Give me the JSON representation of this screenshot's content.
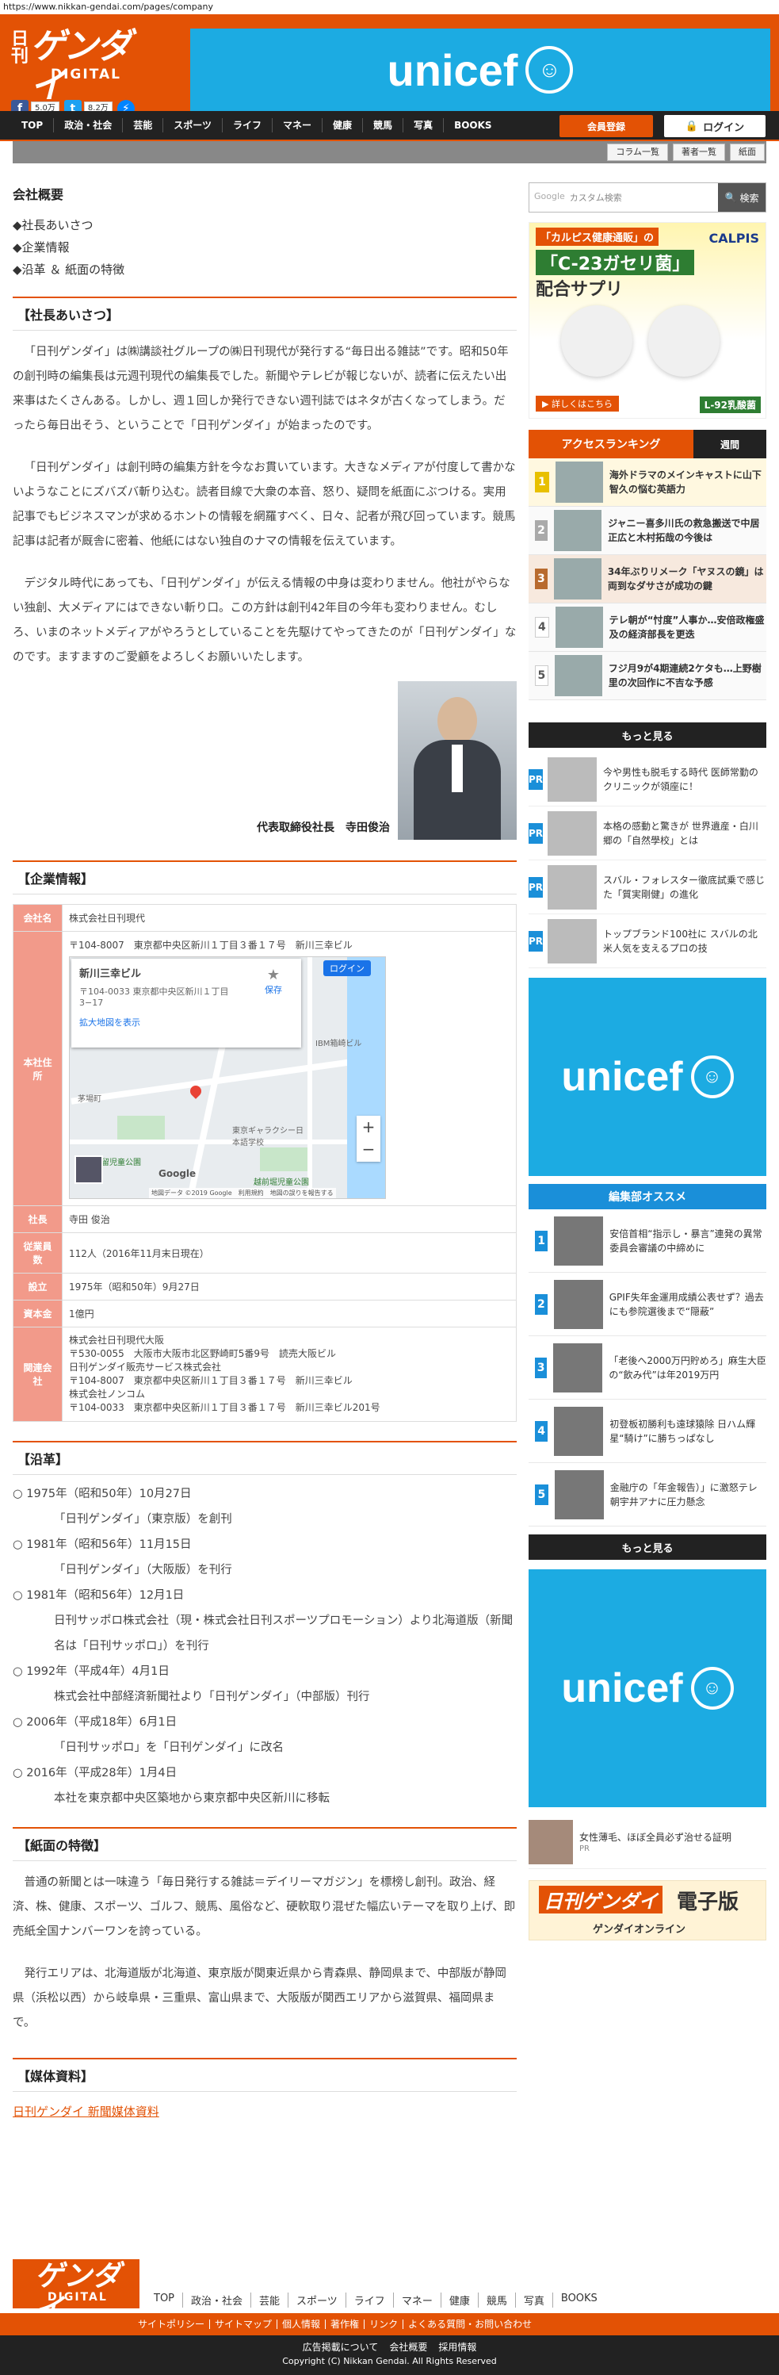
{
  "url": "https://www.nikkan-gendai.com/pages/company",
  "header": {
    "logo_vertical": "日刊",
    "logo_main": "ゲンダイ",
    "logo_sub": "DIGITAL",
    "fb_count": "5.0万",
    "tw_count": "8.2万",
    "banner_text": "unicef"
  },
  "nav": {
    "items": [
      "TOP",
      "政治・社会",
      "芸能",
      "スポーツ",
      "ライフ",
      "マネー",
      "健康",
      "競馬",
      "写真",
      "BOOKS"
    ],
    "register": "会員登録",
    "login": "ログイン"
  },
  "subnav": [
    "コラム一覧",
    "著者一覧",
    "紙面"
  ],
  "page": {
    "title": "会社概要",
    "toc": [
      "◆社長あいさつ",
      "◆企業情報",
      "◆沿革 ＆ 紙面の特徴"
    ]
  },
  "greeting": {
    "heading": "【社長あいさつ】",
    "p1": "「日刊ゲンダイ」は㈱講談社グループの㈱日刊現代が発行する“毎日出る雑誌”です。昭和50年の創刊時の編集長は元週刊現代の編集長でした。新聞やテレビが報じないが、読者に伝えたい出来事はたくさんある。しかし、週１回しか発行できない週刊誌ではネタが古くなってしまう。だったら毎日出そう、ということで「日刊ゲンダイ」が始まったのです。",
    "p2": "「日刊ゲンダイ」は創刊時の編集方針を今なお貫いています。大きなメディアが付度して書かないようなことにズバズバ斬り込む。読者目線で大衆の本音、怒り、疑問を紙面にぶつける。実用記事でもビジネスマンが求めるホントの情報を網羅すべく、日々、記者が飛び回っています。競馬記事は記者が厩舎に密着、他紙にはない独自のナマの情報を伝えています。",
    "p3": "デジタル時代にあっても、「日刊ゲンダイ」が伝える情報の中身は変わりません。他社がやらない独創、大メディアにはできない斬り口。この方針は創刊42年目の今年も変わりません。むしろ、いまのネットメディアがやろうとしていることを先駆けてやってきたのが「日刊ゲンダイ」なのです。ますますのご愛顧をよろしくお願いいたします。",
    "caption": "代表取締役社長　寺田俊治"
  },
  "company": {
    "heading": "【企業情報】",
    "rows": [
      {
        "k": "会社名",
        "v": "株式会社日刊現代"
      },
      {
        "k": "社長",
        "v": "寺田 俊治"
      },
      {
        "k": "従業員数",
        "v": "112人（2016年11月末日現在）"
      },
      {
        "k": "設立",
        "v": "1975年（昭和50年）9月27日"
      },
      {
        "k": "資本金",
        "v": "1億円"
      }
    ],
    "address_key": "本社住所",
    "address": "〒104-8007　東京都中央区新川１丁目３番１７号　新川三幸ビル",
    "map": {
      "place": "新川三幸ビル",
      "place_addr": "〒104-0033 東京都中央区新川１丁目 3−17",
      "save": "保存",
      "enlarge": "拡大地図を表示",
      "login": "ログイン",
      "label1": "IBM箱崎ビル",
      "label2": "東京ギャラクシー日本語学校",
      "label3": "堀留児童公園",
      "label4": "茅場町",
      "label5": "越前堀児童公園",
      "footer": "地図データ ©2019 Google　利用規約　地図の誤りを報告する",
      "google": "Google"
    },
    "related_key": "関連会社",
    "related": [
      "株式会社日刊現代大阪",
      "〒530-0055　大阪市大阪市北区野崎町5番9号　読売大阪ビル",
      "日刊ゲンダイ販売サービス株式会社",
      "〒104-8007　東京都中央区新川１丁目３番１７号　新川三幸ビル",
      "株式会社ノンコム",
      "〒104-0033　東京都中央区新川１丁目３番１７号　新川三幸ビル201号"
    ]
  },
  "history": {
    "heading": "【沿革】",
    "items": [
      {
        "date": "○ 1975年（昭和50年）10月27日",
        "desc": "「日刊ゲンダイ」（東京版）を創刊"
      },
      {
        "date": "○ 1981年（昭和56年）11月15日",
        "desc": "「日刊ゲンダイ」（大阪版）を刊行"
      },
      {
        "date": "○ 1981年（昭和56年）12月1日",
        "desc": "日刊サッポロ株式会社（現・株式会社日刊スポーツプロモーション）より北海道版（新聞名は「日刊サッポロ」）を刊行"
      },
      {
        "date": "○ 1992年（平成4年）4月1日",
        "desc": "株式会社中部経済新聞社より「日刊ゲンダイ」（中部版）刊行"
      },
      {
        "date": "○ 2006年（平成18年）6月1日",
        "desc": "「日刊サッポロ」を「日刊ゲンダイ」に改名"
      },
      {
        "date": "○ 2016年（平成28年）1月4日",
        "desc": "本社を東京都中央区築地から東京都中央区新川に移転"
      }
    ]
  },
  "features": {
    "heading": "【紙面の特徴】",
    "p1": "普通の新聞とは一味違う「毎日発行する雑誌＝デイリーマガジン」を標榜し創刊。政治、経済、株、健康、スポーツ、ゴルフ、競馬、風俗など、硬軟取り混ぜた幅広いテーマを取り上げ、即売紙全国ナンバーワンを誇っている。",
    "p2": "発行エリアは、北海道版が北海道、東京版が関東近県から青森県、静岡県まで、中部版が静岡県（浜松以西）から岐阜県・三重県、富山県まで、大阪版が関西エリアから滋賀県、福岡県まで。"
  },
  "media": {
    "heading": "【媒体資料】",
    "link": "日刊ゲンダイ 新聞媒体資料"
  },
  "side": {
    "search_placeholder": "カスタム検索",
    "search_brand": "Google",
    "search_button": "検索",
    "ad1": {
      "title": "「カルピス健康通販」の",
      "main": "「C-23ガセリ菌」",
      "sub": "配合サプリ",
      "brand": "CALPIS",
      "note": "▶ 詳しくはこちら",
      "tag": "L-92乳酸菌"
    },
    "ranking_tab": "アクセスランキング",
    "ranking_tab2": "週間",
    "ranking": [
      {
        "n": "1",
        "t": "海外ドラマのメインキャストに山下智久の悩む英語力"
      },
      {
        "n": "2",
        "t": "ジャニー喜多川氏の救急搬送で中居正広と木村拓哉の今後は"
      },
      {
        "n": "3",
        "t": "34年ぶりリメーク「ヤヌスの鏡」は両到なダサさが成功の鍵"
      },
      {
        "n": "4",
        "t": "テレ朝が“忖度”人事か…安倍政権盛及の経済部長を更迭"
      },
      {
        "n": "5",
        "t": "フジ月9が4期連続2ケタも…上野樹里の次回作に不吉な予感"
      }
    ],
    "more": "もっと見る",
    "pr": [
      {
        "t": "今や男性も脱毛する時代 医師常勤のクリニックが領座に！"
      },
      {
        "t": "本格の感動と驚きが 世界遺産・白川郷の「自然學校」とは"
      },
      {
        "t": "スバル・フォレスター徹底試乗で感じた「質実剛健」の進化"
      },
      {
        "t": "トップブランド100社に スバルの北米人気を支えるプロの技"
      }
    ],
    "pr_label": "PR",
    "editor_heading": "編集部オススメ",
    "editor": [
      {
        "n": "1",
        "t": "安倍首相“指示し・暴言”連発の異常 委員会審議の中締めに"
      },
      {
        "n": "2",
        "t": "GPIF失年金運用成績公表せず？過去にも参院選後まで“隠蔽”"
      },
      {
        "n": "3",
        "t": "「老後へ2000万円貯めろ」麻生大臣の“飲み代”は年2019万円"
      },
      {
        "n": "4",
        "t": "初登板初勝利も遠球猿除 日ハム輝星“騎け”に勝ちっぱなし"
      },
      {
        "n": "5",
        "t": "金融庁の「年金報告）」に激怒テレ朝宇井アナに圧力懸念"
      }
    ],
    "last_pr": "女性薄毛、ほぼ全員必ず治せる証明",
    "ebook_logo": "日刊ゲンダイ",
    "ebook_text": "電子版",
    "ebook_sub": "ゲンダイオンライン"
  },
  "footer": {
    "logo_main": "ゲンダイ",
    "logo_sub": "DIGITAL",
    "nav": [
      "TOP",
      "政治・社会",
      "芸能",
      "スポーツ",
      "ライフ",
      "マネー",
      "健康",
      "競馬",
      "写真",
      "BOOKS"
    ],
    "links": [
      "サイトポリシー",
      "サイトマップ",
      "個人情報",
      "著作権",
      "リンク",
      "よくある質問・お問い合わせ"
    ],
    "links2": [
      "広告掲載について",
      "会社概要",
      "採用情報"
    ],
    "copyright": "Copyright (C) Nikkan Gendai. All Rights Reserved"
  },
  "colors": {
    "brand": "#e35205",
    "unicef": "#1cabe2",
    "dark": "#222222"
  }
}
